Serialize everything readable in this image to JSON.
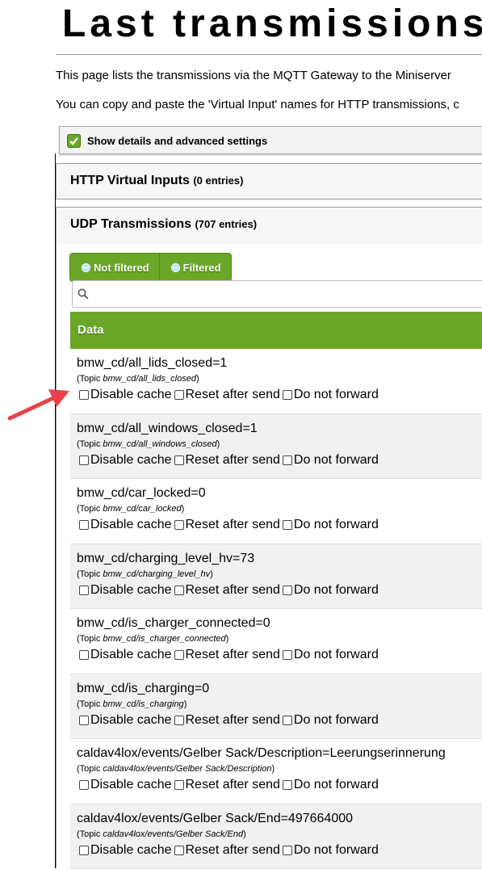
{
  "page": {
    "title": "Last transmissions",
    "intro_line1": "This page lists the transmissions via the MQTT Gateway to the Miniserver",
    "intro_line2": "You can copy and paste the 'Virtual Input' names for HTTP transmissions, c"
  },
  "details_toggle": {
    "label": "Show details and advanced settings",
    "checked": true
  },
  "http_section": {
    "title": "HTTP Virtual Inputs",
    "count": "(0 entries)"
  },
  "udp_section": {
    "title": "UDP Transmissions",
    "count": "(707 entries)"
  },
  "filters": {
    "not_filtered": "Not filtered",
    "filtered": "Filtered"
  },
  "search": {
    "value": "",
    "placeholder": ""
  },
  "table": {
    "header": "Data"
  },
  "option_labels": {
    "disable_cache": "Disable cache",
    "reset_after_send": "Reset after send",
    "do_not_forward": "Do not forward"
  },
  "topic_prefix": "(Topic ",
  "topic_suffix": ")",
  "rows": [
    {
      "main": "bmw_cd/all_lids_closed=1",
      "topic": "bmw_cd/all_lids_closed"
    },
    {
      "main": "bmw_cd/all_windows_closed=1",
      "topic": "bmw_cd/all_windows_closed"
    },
    {
      "main": "bmw_cd/car_locked=0",
      "topic": "bmw_cd/car_locked"
    },
    {
      "main": "bmw_cd/charging_level_hv=73",
      "topic": "bmw_cd/charging_level_hv"
    },
    {
      "main": "bmw_cd/is_charger_connected=0",
      "topic": "bmw_cd/is_charger_connected"
    },
    {
      "main": "bmw_cd/is_charging=0",
      "topic": "bmw_cd/is_charging"
    },
    {
      "main": "caldav4lox/events/Gelber Sack/Description=Leerungserinnerung",
      "topic": "caldav4lox/events/Gelber Sack/Description"
    },
    {
      "main": "caldav4lox/events/Gelber Sack/End=497664000",
      "topic": "caldav4lox/events/Gelber Sack/End"
    }
  ],
  "colors": {
    "accent_green": "#6aa728",
    "annotation_arrow": "#e8414a"
  },
  "icons": {
    "check": "check-icon",
    "search": "search-icon",
    "filter_dot": "circle-minus-icon",
    "arrow": "arrow-annotation-icon"
  }
}
